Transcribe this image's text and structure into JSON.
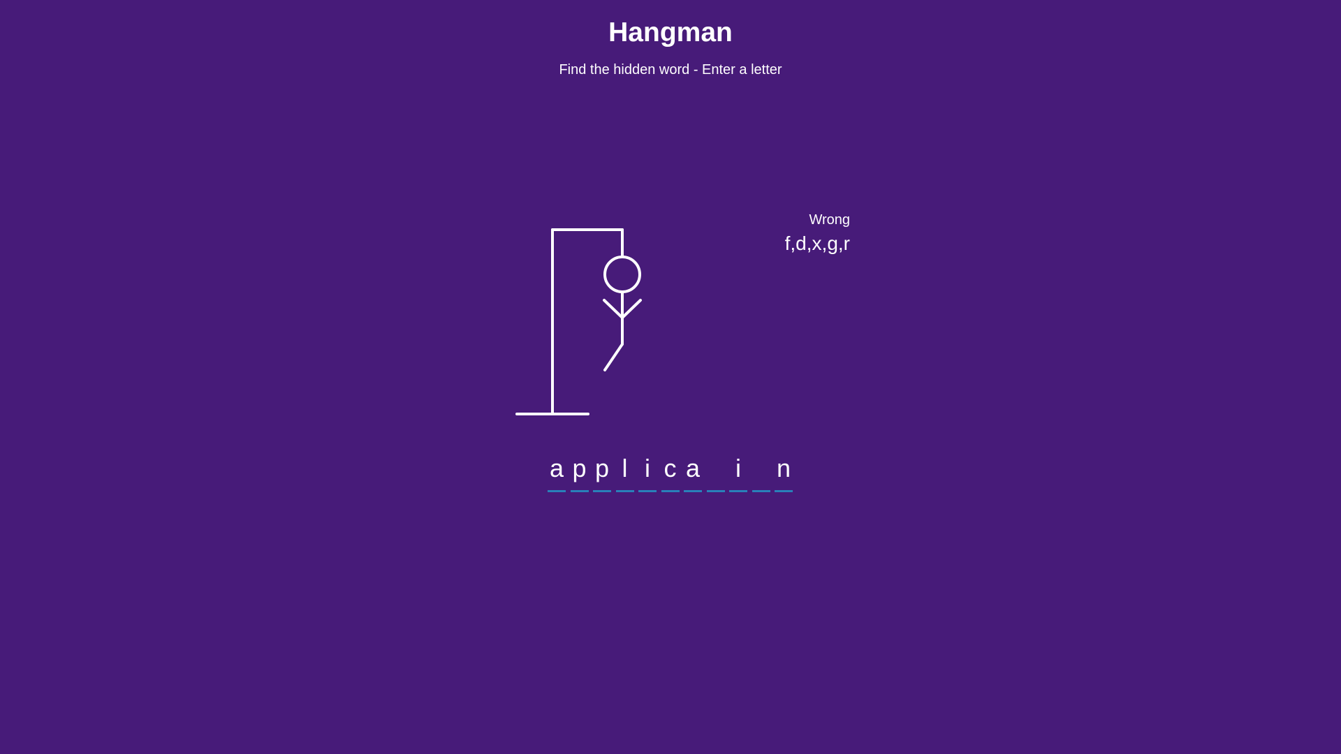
{
  "header": {
    "title": "Hangman",
    "subtitle": "Find the hidden word - Enter a letter"
  },
  "wrong": {
    "label": "Wrong",
    "letters": "f,d,x,g,r"
  },
  "figure": {
    "wrong_guess_count": 5,
    "parts_shown": [
      "head",
      "body",
      "left-arm",
      "right-arm",
      "left-leg"
    ]
  },
  "word": {
    "letters": [
      "a",
      "p",
      "p",
      "l",
      "i",
      "c",
      "a",
      "",
      "i",
      "",
      "n"
    ]
  },
  "colors": {
    "background": "#471b79",
    "foreground": "#ffffff",
    "letter_underline": "#2980b9"
  }
}
